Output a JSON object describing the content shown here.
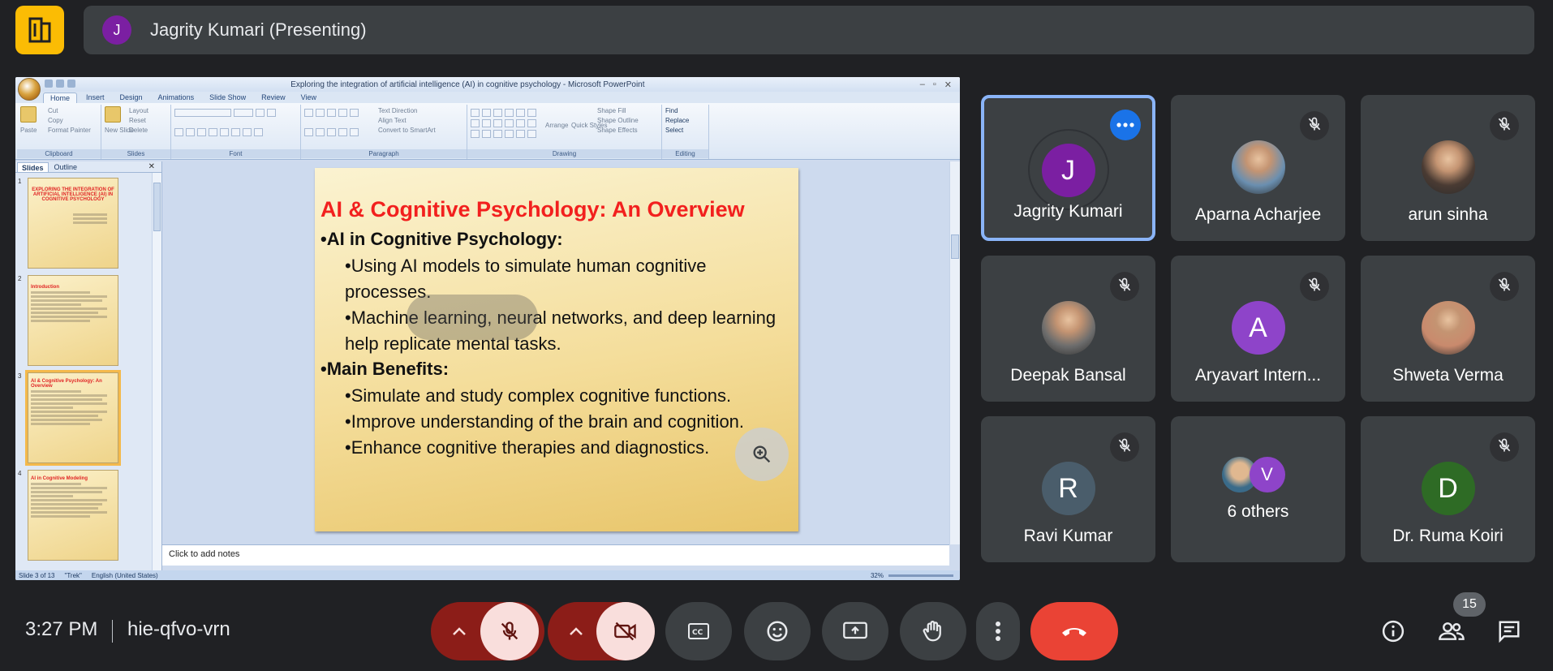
{
  "presenter_bar": {
    "avatar_letter": "J",
    "label": "Jagrity Kumari (Presenting)"
  },
  "ppt": {
    "window_title": "Exploring the integration of artificial intelligence (AI) in cognitive psychology - Microsoft PowerPoint",
    "tabs": [
      "Home",
      "Insert",
      "Design",
      "Animations",
      "Slide Show",
      "Review",
      "View"
    ],
    "groups": {
      "clipboard": "Clipboard",
      "slides": "Slides",
      "font": "Font",
      "paragraph": "Paragraph",
      "drawing": "Drawing",
      "editing": "Editing"
    },
    "ribbon_items": {
      "paste": "Paste",
      "cut": "Cut",
      "copy": "Copy",
      "format_painter": "Format Painter",
      "new_slide": "New Slide",
      "layout": "Layout",
      "reset": "Reset",
      "delete": "Delete",
      "text_direction": "Text Direction",
      "align_text": "Align Text",
      "convert_smartart": "Convert to SmartArt",
      "arrange": "Arrange",
      "quick_styles": "Quick Styles",
      "shape_fill": "Shape Fill",
      "shape_outline": "Shape Outline",
      "shape_effects": "Shape Effects",
      "find": "Find",
      "replace": "Replace",
      "select": "Select"
    },
    "panel_tabs": {
      "slides": "Slides",
      "outline": "Outline"
    },
    "thumbnails": [
      {
        "num": "1",
        "title": "EXPLORING THE INTEGRATION OF ARTIFICIAL INTELLIGENCE (AI) IN COGNITIVE PSYCHOLOGY"
      },
      {
        "num": "2",
        "title": "Introduction"
      },
      {
        "num": "3",
        "title": "AI & Cognitive Psychology: An Overview"
      },
      {
        "num": "4",
        "title": "AI in Cognitive Modeling"
      }
    ],
    "slide": {
      "title": "AI & Cognitive Psychology: An Overview",
      "b1": "•AI in Cognitive Psychology:",
      "b1_1": "•Using AI models to simulate human cognitive processes.",
      "b1_2": "•Machine learning, neural networks, and deep learning help replicate mental tasks.",
      "b2": "•Main Benefits:",
      "b2_1": "•Simulate and study complex cognitive functions.",
      "b2_2": "•Improve understanding of the brain and cognition.",
      "b2_3": "•Enhance cognitive therapies and diagnostics."
    },
    "notes_placeholder": "Click to add notes",
    "status": {
      "slide": "Slide 3 of 13",
      "theme": "\"Trek\"",
      "language": "English (United States)",
      "zoom": "32%"
    }
  },
  "participants": [
    {
      "name": "Jagrity Kumari",
      "letter": "J",
      "color": "#7b1fa2",
      "muted": false,
      "active": true,
      "photo": false
    },
    {
      "name": "Aparna Acharjee",
      "letter": "",
      "color": "#6a8fb0",
      "muted": true,
      "active": false,
      "photo": true
    },
    {
      "name": "arun sinha",
      "letter": "",
      "color": "#4a3b33",
      "muted": true,
      "active": false,
      "photo": true
    },
    {
      "name": "Deepak Bansal",
      "letter": "",
      "color": "#6d6d6d",
      "muted": true,
      "active": false,
      "photo": true
    },
    {
      "name": "Aryavart Intern...",
      "letter": "A",
      "color": "#8e44c9",
      "muted": true,
      "active": false,
      "photo": false
    },
    {
      "name": "Shweta Verma",
      "letter": "",
      "color": "#c98a6d",
      "muted": true,
      "active": false,
      "photo": true
    },
    {
      "name": "Ravi Kumar",
      "letter": "R",
      "color": "#4a5d6b",
      "muted": true,
      "active": false,
      "photo": false
    },
    {
      "name": "6 others",
      "letter": "V",
      "color": "#8e44c9",
      "muted": false,
      "active": false,
      "photo": false
    },
    {
      "name": "Dr. Ruma Koiri",
      "letter": "D",
      "color": "#2e6b25",
      "muted": true,
      "active": false,
      "photo": false
    }
  ],
  "bottom_bar": {
    "time": "3:27 PM",
    "meeting_code": "hie-qfvo-vrn",
    "participant_count": "15"
  },
  "colors": {
    "end_call": "#ea4335",
    "mic_off_bg": "#f9dedc",
    "mic_dropdown_bg": "#8c1d18",
    "active_border": "#8ab4f8"
  }
}
